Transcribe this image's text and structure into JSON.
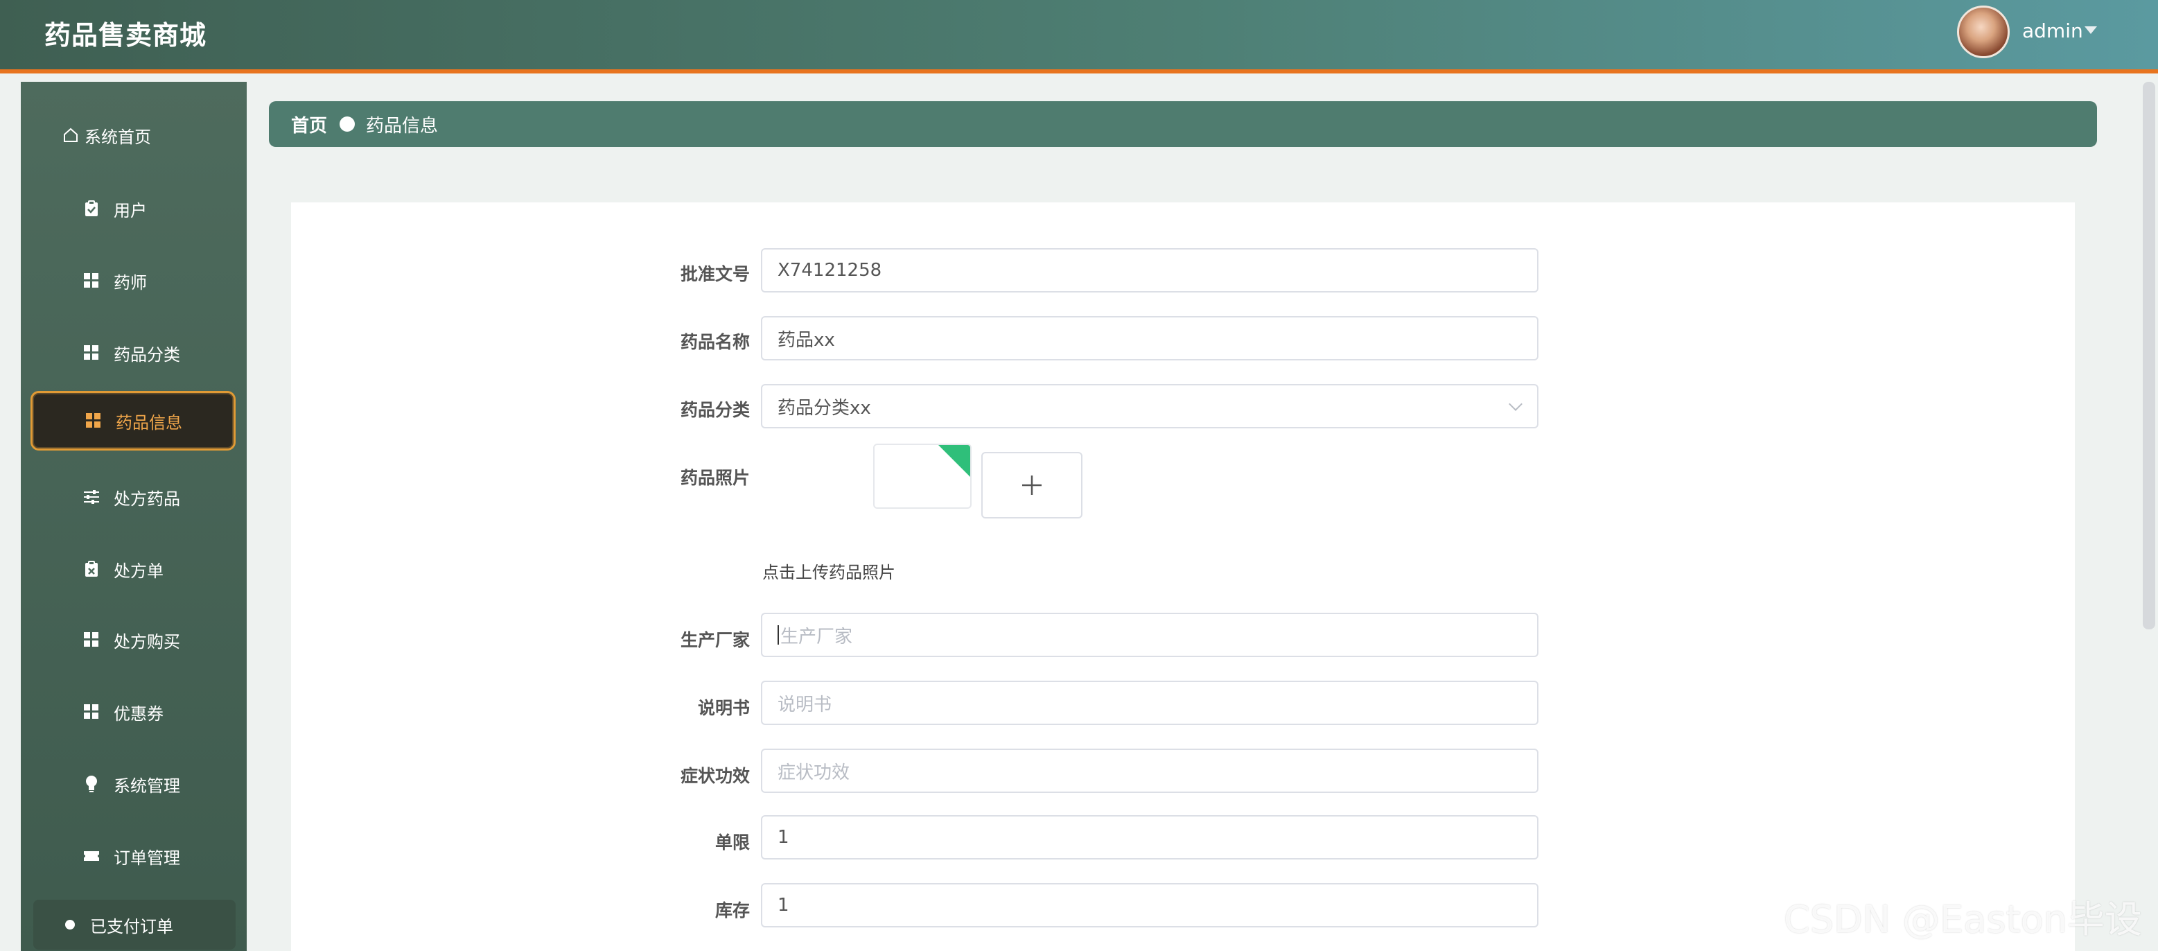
{
  "header": {
    "title": "药品售卖商城",
    "user": "admin"
  },
  "sidebar": {
    "items": [
      {
        "label": "系统首页",
        "icon": "home-icon"
      },
      {
        "label": "用户",
        "icon": "clipboard-icon"
      },
      {
        "label": "药师",
        "icon": "grid-icon"
      },
      {
        "label": "药品分类",
        "icon": "grid-icon"
      },
      {
        "label": "药品信息",
        "icon": "grid-icon",
        "active": true
      },
      {
        "label": "处方药品",
        "icon": "sliders-icon"
      },
      {
        "label": "处方单",
        "icon": "clipboard-x-icon"
      },
      {
        "label": "处方购买",
        "icon": "grid-icon"
      },
      {
        "label": "优惠券",
        "icon": "grid-icon"
      },
      {
        "label": "系统管理",
        "icon": "bulb-icon"
      },
      {
        "label": "订单管理",
        "icon": "ticket-icon"
      }
    ],
    "sub_item": "已支付订单"
  },
  "breadcrumb": {
    "home": "首页",
    "current": "药品信息"
  },
  "form": {
    "approval_no": {
      "label": "批准文号",
      "value": "X74121258"
    },
    "drug_name": {
      "label": "药品名称",
      "value": "药品xx"
    },
    "category": {
      "label": "药品分类",
      "value": "药品分类xx"
    },
    "photo": {
      "label": "药品照片",
      "hint": "点击上传药品照片"
    },
    "manufacturer": {
      "label": "生产厂家",
      "placeholder": "生产厂家"
    },
    "manual": {
      "label": "说明书",
      "placeholder": "说明书"
    },
    "efficacy": {
      "label": "症状功效",
      "placeholder": "症状功效"
    },
    "limit": {
      "label": "单限",
      "value": "1"
    },
    "stock": {
      "label": "库存",
      "value": "1"
    }
  },
  "watermark": "CSDN @Easton毕设"
}
